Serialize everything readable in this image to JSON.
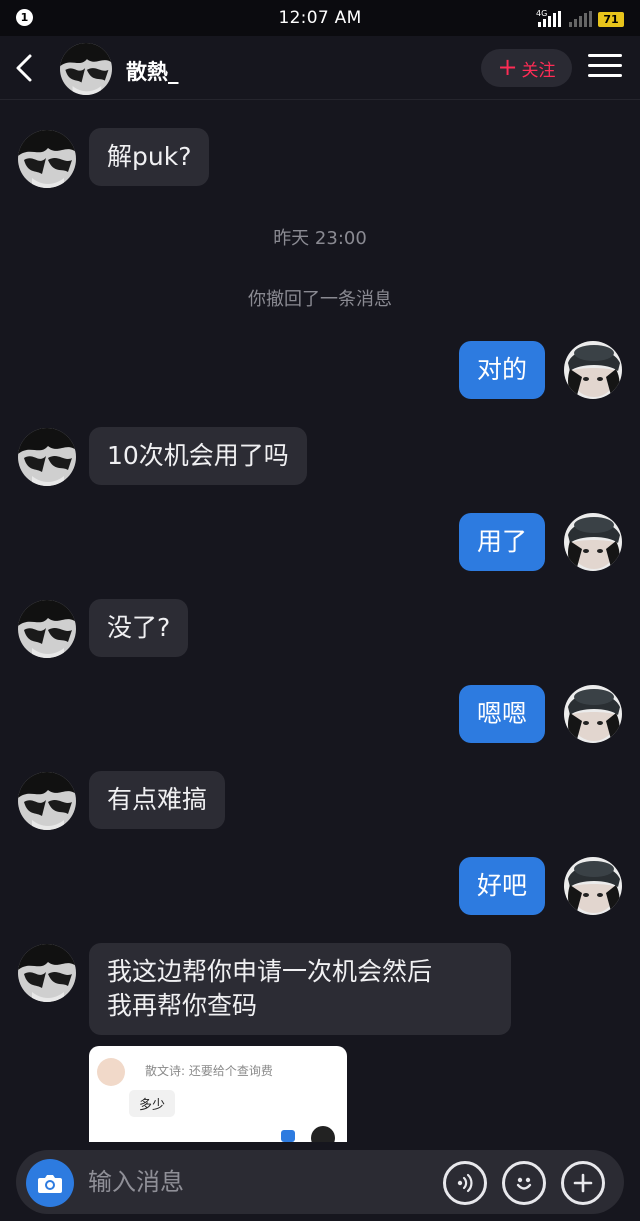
{
  "status_bar": {
    "notification_count": "1",
    "time": "12:07 AM",
    "network": "4G",
    "battery": "71"
  },
  "header": {
    "contact_name": "散熱_",
    "follow_label": "关注",
    "follow_plus": "+",
    "icons": {
      "back": "chevron-left-icon",
      "menu": "hamburger-menu-icon"
    }
  },
  "messages": [
    {
      "side": "in",
      "text": "解puk?"
    },
    {
      "type": "timestamp",
      "text": "昨天 23:00"
    },
    {
      "type": "system",
      "text": "你撤回了一条消息"
    },
    {
      "side": "out",
      "text": "对的"
    },
    {
      "side": "in",
      "text": "10次机会用了吗"
    },
    {
      "side": "out",
      "text": "用了"
    },
    {
      "side": "in",
      "text": "没了?"
    },
    {
      "side": "out",
      "text": "嗯嗯"
    },
    {
      "side": "in",
      "text": "有点难搞"
    },
    {
      "side": "out",
      "text": "好吧"
    },
    {
      "side": "in",
      "lines": [
        "我这边帮你申请一次机会然后",
        "我再帮你查码"
      ]
    },
    {
      "side": "in",
      "type": "image",
      "card_name": "散文诗: 还要给个查询费",
      "card_msg": "多少"
    }
  ],
  "input": {
    "placeholder": "输入消息",
    "icons": [
      "camera-icon",
      "voice-icon",
      "emoji-icon",
      "add-icon"
    ]
  },
  "colors": {
    "background": "#16161e",
    "bubble_in": "#2c2c34",
    "bubble_out": "#2d7be0",
    "follow_accent": "#fe2c55",
    "battery": "#e8c41b"
  }
}
